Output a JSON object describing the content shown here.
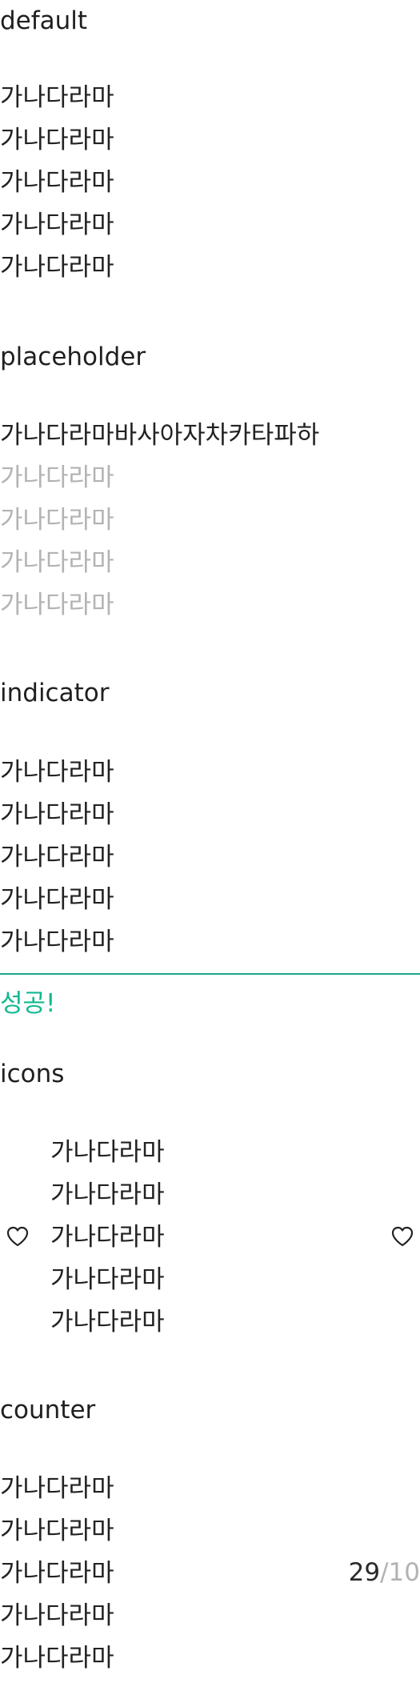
{
  "sections": {
    "default": {
      "title": "default",
      "lines": [
        "가나다라마",
        "가나다라마",
        "가나다라마",
        "가나다라마",
        "가나다라마"
      ]
    },
    "placeholder": {
      "title": "placeholder",
      "value": "가나다라마바사아자차카타파하",
      "placeholder_lines": [
        "가나다라마",
        "가나다라마",
        "가나다라마",
        "가나다라마"
      ]
    },
    "indicator": {
      "title": "indicator",
      "lines": [
        "가나다라마",
        "가나다라마",
        "가나다라마",
        "가나다라마",
        "가나다라마"
      ],
      "helper_text": "성공!",
      "indicator_color": "#1aa88a",
      "helper_color": "#11b88f"
    },
    "icons": {
      "title": "icons",
      "lines": [
        "가나다라마",
        "가나다라마",
        "가나다라마",
        "가나다라마",
        "가나다라마"
      ],
      "left_icon": "heart-icon",
      "right_icon": "heart-icon"
    },
    "counter": {
      "title": "counter",
      "lines": [
        "가나다라마",
        "가나다라마",
        "가나다라마",
        "가나다라마",
        "가나다라마"
      ],
      "current": "29",
      "separator": "/",
      "max": "10"
    }
  }
}
